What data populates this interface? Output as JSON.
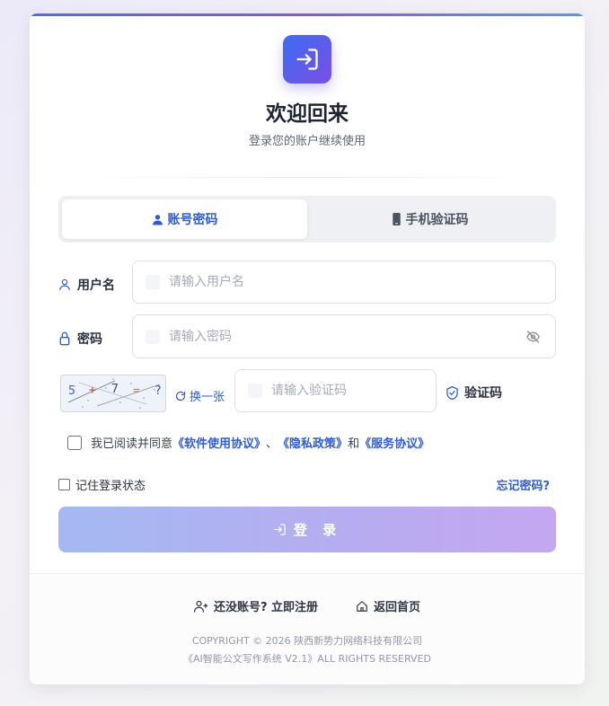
{
  "header": {
    "title": "欢迎回来",
    "subtitle": "登录您的账户继续使用"
  },
  "tabs": [
    {
      "label": "账号密码",
      "active": true,
      "icon": "user-icon"
    },
    {
      "label": "手机验证码",
      "active": false,
      "icon": "phone-icon"
    }
  ],
  "form": {
    "username": {
      "label": "用户名",
      "placeholder": "请输入用户名",
      "value": "",
      "icon": "user-outline-icon"
    },
    "password": {
      "label": "密码",
      "placeholder": "请输入密码",
      "value": "",
      "icon": "lock-icon"
    },
    "captcha": {
      "image_text": [
        "5",
        "+",
        "7",
        "=",
        "?"
      ],
      "refresh_label": "换一张",
      "placeholder": "请输入验证码",
      "value": "",
      "verify_label": "验证码"
    },
    "agreement": {
      "prefix": "我已阅读并同意",
      "link1": "《软件使用协议》",
      "sep": "、",
      "link2": "《隐私政策》",
      "and": "和",
      "link3": "《服务协议》",
      "checked": false
    },
    "remember": {
      "label": "记住登录状态",
      "checked": false
    },
    "forgot_label": "忘记密码?",
    "login_label": "登 录"
  },
  "footer": {
    "register_label": "还没账号? 立即注册",
    "home_label": "返回首页",
    "copyright1": "COPYRIGHT © 2026 陕西新势力网络科技有限公司",
    "copyright2": "《AI智能公文写作系统 V2.1》ALL RIGHTS RESERVED"
  },
  "colors": {
    "accent": "#2e5bd6",
    "logo_gradient_start": "#3b6cf0",
    "logo_gradient_end": "#7b4fe6",
    "button_gradient_start": "#a4b9f2",
    "button_gradient_end": "#c4a7f1"
  }
}
